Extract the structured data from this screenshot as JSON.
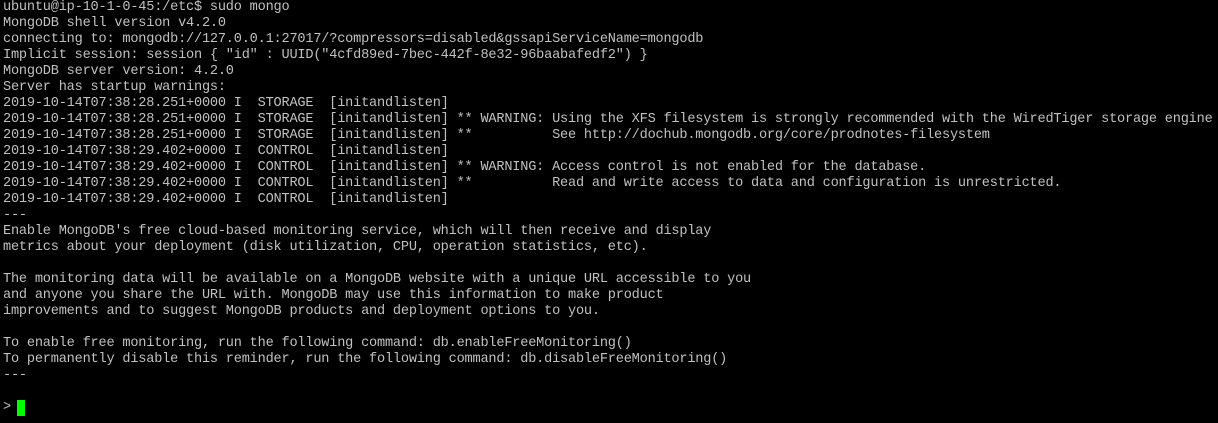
{
  "terminal": {
    "lines": [
      "ubuntu@ip-10-1-0-45:/etc$ sudo mongo",
      "MongoDB shell version v4.2.0",
      "connecting to: mongodb://127.0.0.1:27017/?compressors=disabled&gssapiServiceName=mongodb",
      "Implicit session: session { \"id\" : UUID(\"4cfd89ed-7bec-442f-8e32-96baabafedf2\") }",
      "MongoDB server version: 4.2.0",
      "Server has startup warnings:",
      "2019-10-14T07:38:28.251+0000 I  STORAGE  [initandlisten]",
      "2019-10-14T07:38:28.251+0000 I  STORAGE  [initandlisten] ** WARNING: Using the XFS filesystem is strongly recommended with the WiredTiger storage engine",
      "2019-10-14T07:38:28.251+0000 I  STORAGE  [initandlisten] **          See http://dochub.mongodb.org/core/prodnotes-filesystem",
      "2019-10-14T07:38:29.402+0000 I  CONTROL  [initandlisten]",
      "2019-10-14T07:38:29.402+0000 I  CONTROL  [initandlisten] ** WARNING: Access control is not enabled for the database.",
      "2019-10-14T07:38:29.402+0000 I  CONTROL  [initandlisten] **          Read and write access to data and configuration is unrestricted.",
      "2019-10-14T07:38:29.402+0000 I  CONTROL  [initandlisten]",
      "---",
      "Enable MongoDB's free cloud-based monitoring service, which will then receive and display",
      "metrics about your deployment (disk utilization, CPU, operation statistics, etc).",
      "",
      "The monitoring data will be available on a MongoDB website with a unique URL accessible to you",
      "and anyone you share the URL with. MongoDB may use this information to make product",
      "improvements and to suggest MongoDB products and deployment options to you.",
      "",
      "To enable free monitoring, run the following command: db.enableFreeMonitoring()",
      "To permanently disable this reminder, run the following command: db.disableFreeMonitoring()",
      "---",
      ""
    ],
    "prompt": ">",
    "colors": {
      "background": "#000000",
      "text": "#c0c0c0",
      "cursor": "#00ff00"
    }
  }
}
